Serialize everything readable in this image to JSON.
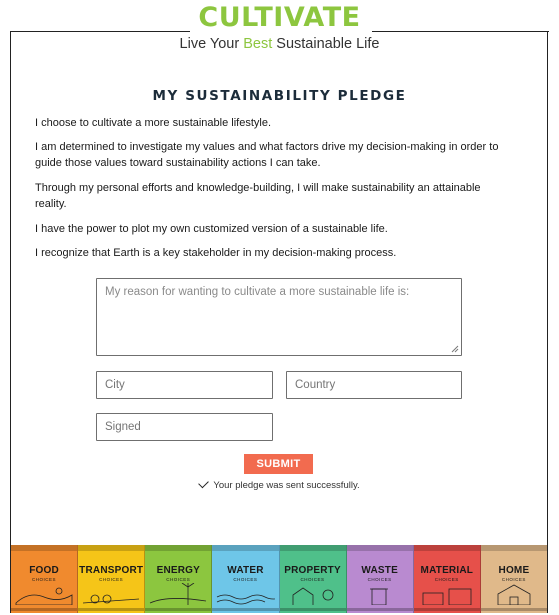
{
  "brand": {
    "name": "CULTIVATE",
    "tagline_pre": "Live Your ",
    "tagline_accent": "Best",
    "tagline_post": " Sustainable Life",
    "accent_color": "#8dc63f"
  },
  "form": {
    "title": "MY SUSTAINABILITY PLEDGE",
    "statements": [
      "I choose to cultivate a more sustainable lifestyle.",
      "I am determined to investigate my values and what factors drive my decision-making in order to guide those values toward sustainability actions I can take.",
      "Through my personal efforts and knowledge-building, I will make sustainability an attainable reality.",
      "I have the power to plot my own customized version of a sustainable life.",
      "I recognize that Earth is a key stakeholder in my decision-making process."
    ],
    "reason": {
      "placeholder": "My reason for wanting to cultivate a more sustainable life is:",
      "value": ""
    },
    "city": {
      "placeholder": "City",
      "value": ""
    },
    "country": {
      "placeholder": "Country",
      "value": ""
    },
    "signed": {
      "placeholder": "Signed",
      "value": ""
    },
    "submit_label": "SUBMIT",
    "submit_color": "#f26b4f",
    "success_message": "Your pledge was sent successfully."
  },
  "banner": {
    "cards": [
      {
        "label": "FOOD",
        "sub": "CHOICES",
        "color": "#f08a2e",
        "icon": "food-icon"
      },
      {
        "label": "TRANSPORT",
        "sub": "CHOICES",
        "color": "#f5c518",
        "icon": "transport-icon"
      },
      {
        "label": "ENERGY",
        "sub": "CHOICES",
        "color": "#8cc63f",
        "icon": "energy-icon"
      },
      {
        "label": "WATER",
        "sub": "CHOICES",
        "color": "#6ec6e8",
        "icon": "water-icon"
      },
      {
        "label": "PROPERTY",
        "sub": "CHOICES",
        "color": "#4fc08a",
        "icon": "property-icon"
      },
      {
        "label": "WASTE",
        "sub": "CHOICES",
        "color": "#b98ad0",
        "icon": "waste-icon"
      },
      {
        "label": "MATERIAL",
        "sub": "CHOICES",
        "color": "#e6504a",
        "icon": "material-icon"
      },
      {
        "label": "HOME",
        "sub": "CHOICES",
        "color": "#e0b98a",
        "icon": "home-icon"
      }
    ]
  }
}
